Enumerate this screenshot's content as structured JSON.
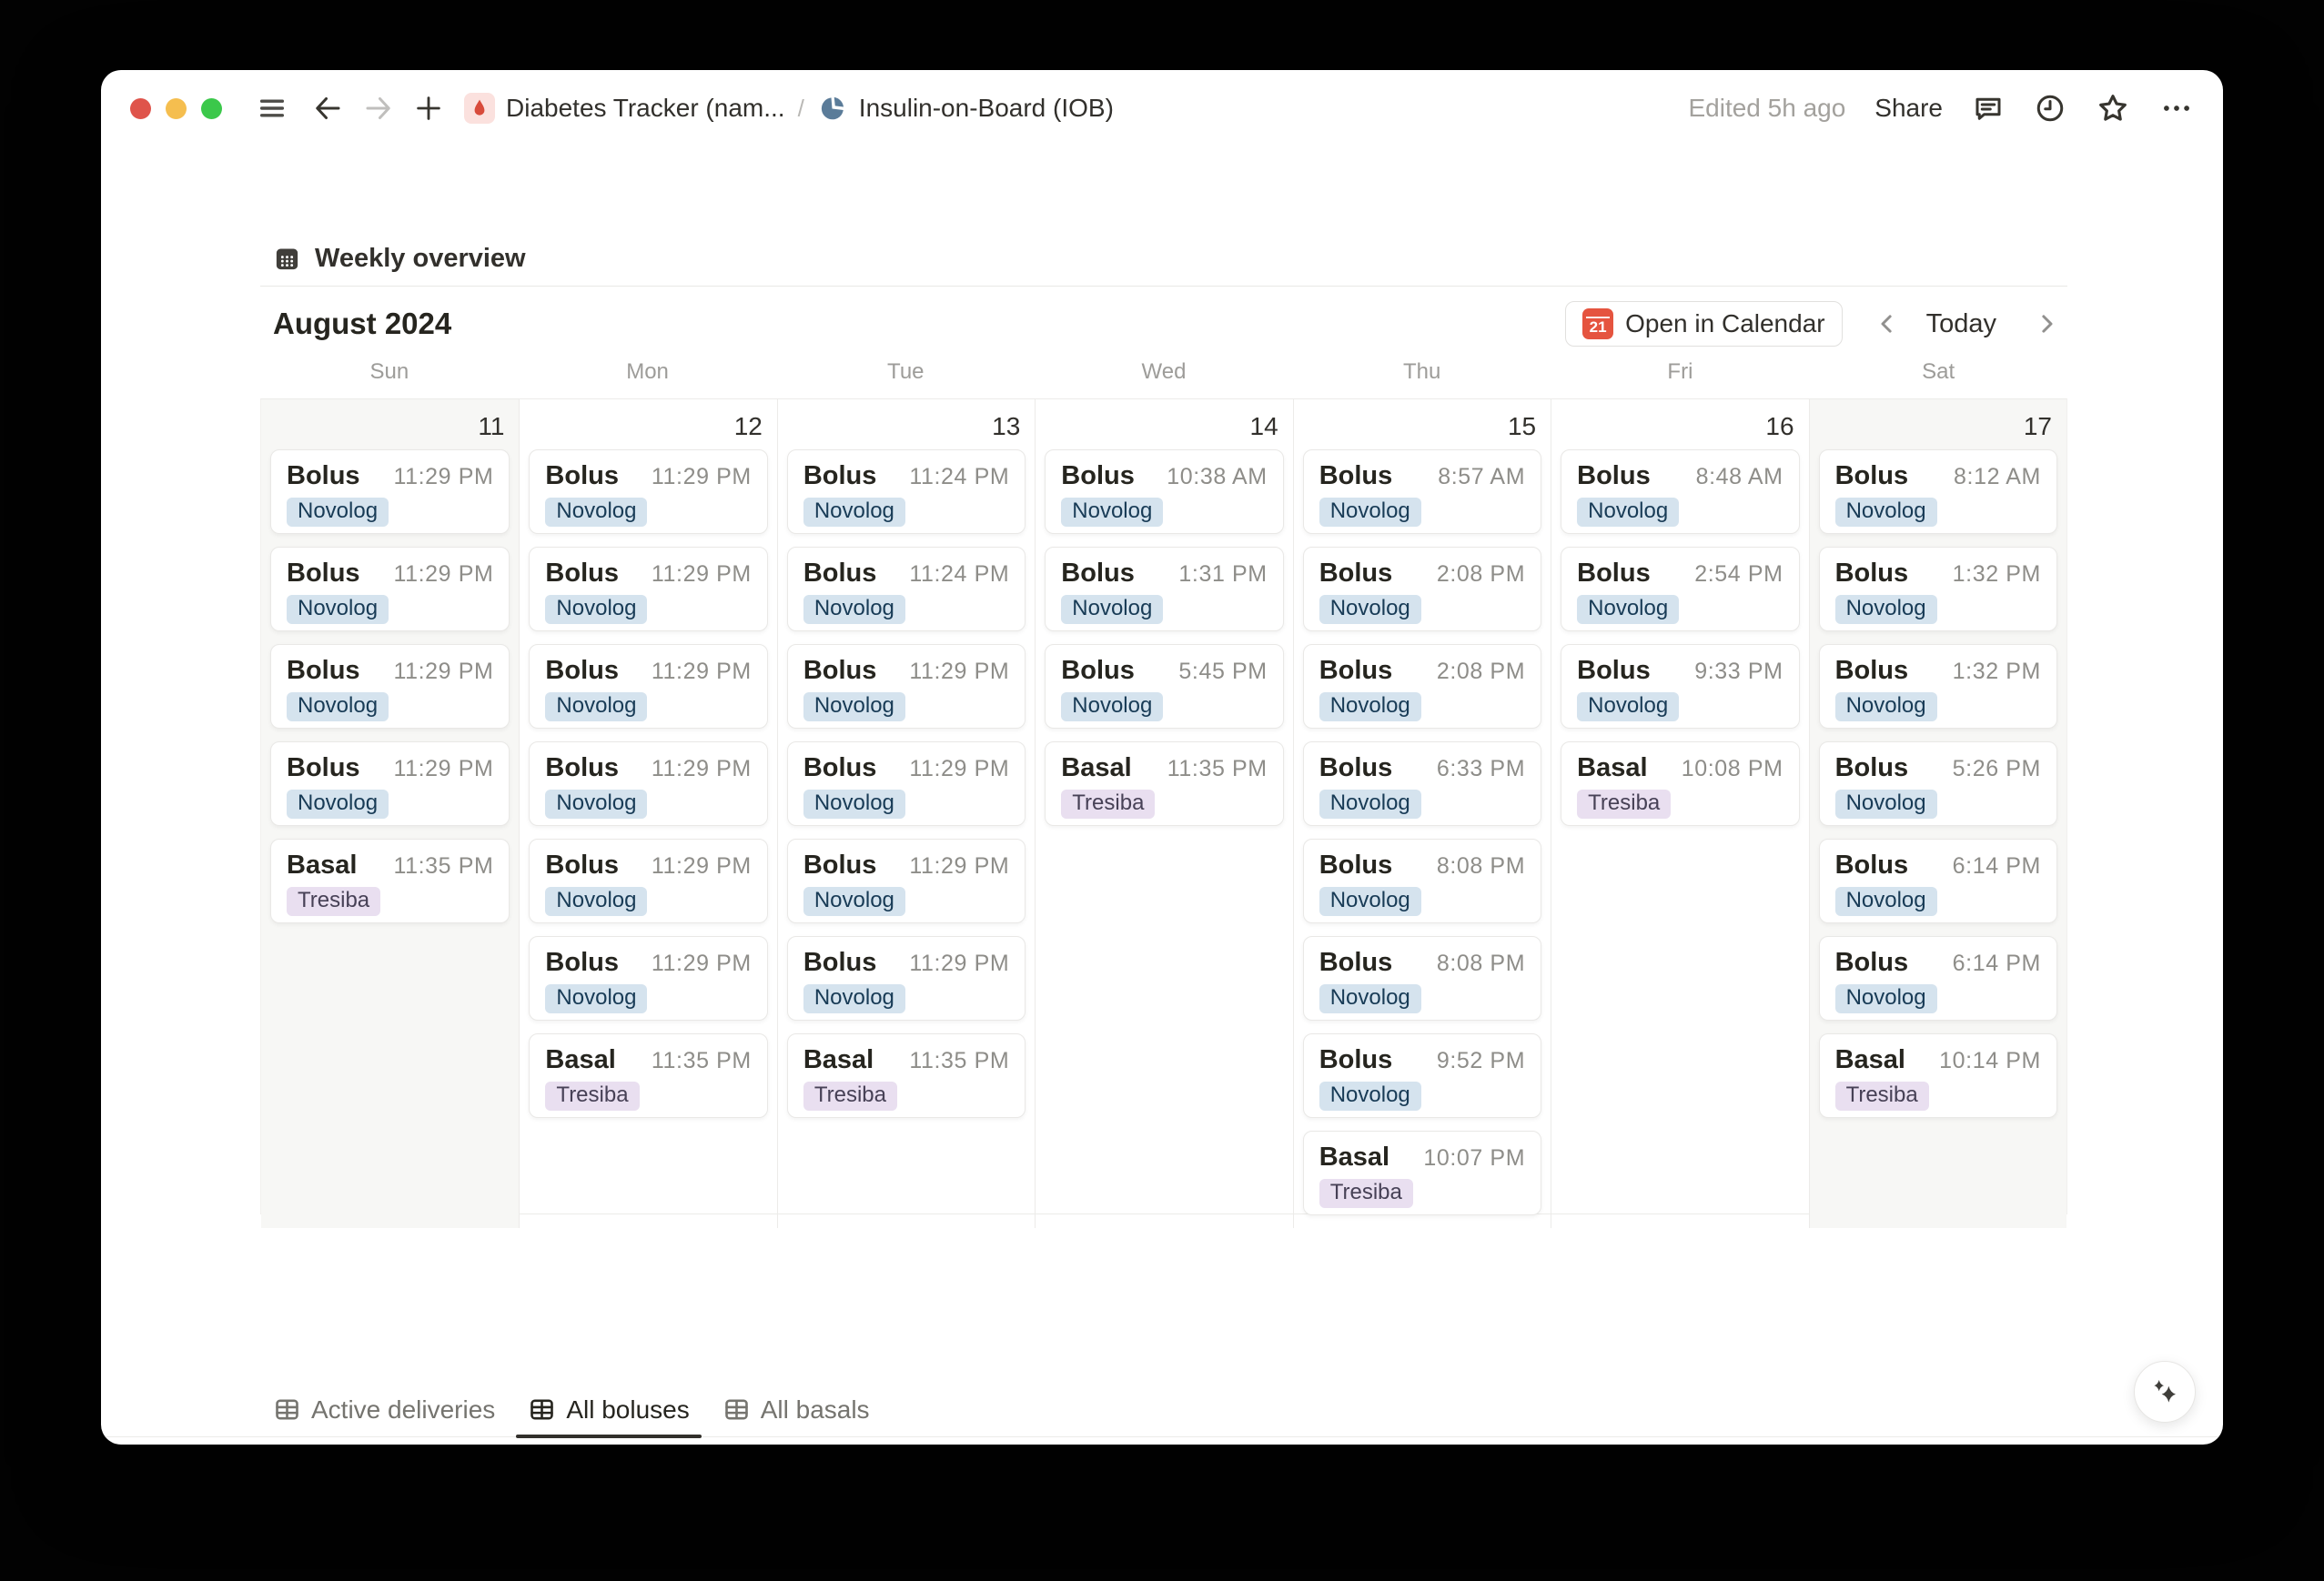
{
  "window": {
    "topbar": {
      "breadcrumb_root": "Diabetes Tracker (nam...",
      "breadcrumb_separator": "/",
      "breadcrumb_page": "Insulin-on-Board (IOB)",
      "edited_label": "Edited 5h ago",
      "share_label": "Share"
    },
    "view_header": {
      "title": "Weekly overview",
      "month_label": "August 2024",
      "open_in_calendar_label": "Open in Calendar",
      "calendar_badge_day": "21",
      "today_label": "Today"
    },
    "calendar": {
      "weekday_headers": [
        "Sun",
        "Mon",
        "Tue",
        "Wed",
        "Thu",
        "Fri",
        "Sat"
      ],
      "days": [
        {
          "date": "11",
          "weekend": true,
          "events": [
            {
              "title": "Bolus",
              "time": "11:29 PM",
              "tag": "Novolog",
              "tag_color": "blue"
            },
            {
              "title": "Bolus",
              "time": "11:29 PM",
              "tag": "Novolog",
              "tag_color": "blue"
            },
            {
              "title": "Bolus",
              "time": "11:29 PM",
              "tag": "Novolog",
              "tag_color": "blue"
            },
            {
              "title": "Bolus",
              "time": "11:29 PM",
              "tag": "Novolog",
              "tag_color": "blue"
            },
            {
              "title": "Basal",
              "time": "11:35 PM",
              "tag": "Tresiba",
              "tag_color": "purple"
            }
          ]
        },
        {
          "date": "12",
          "weekend": false,
          "events": [
            {
              "title": "Bolus",
              "time": "11:29 PM",
              "tag": "Novolog",
              "tag_color": "blue"
            },
            {
              "title": "Bolus",
              "time": "11:29 PM",
              "tag": "Novolog",
              "tag_color": "blue"
            },
            {
              "title": "Bolus",
              "time": "11:29 PM",
              "tag": "Novolog",
              "tag_color": "blue"
            },
            {
              "title": "Bolus",
              "time": "11:29 PM",
              "tag": "Novolog",
              "tag_color": "blue"
            },
            {
              "title": "Bolus",
              "time": "11:29 PM",
              "tag": "Novolog",
              "tag_color": "blue"
            },
            {
              "title": "Bolus",
              "time": "11:29 PM",
              "tag": "Novolog",
              "tag_color": "blue"
            },
            {
              "title": "Basal",
              "time": "11:35 PM",
              "tag": "Tresiba",
              "tag_color": "purple"
            }
          ]
        },
        {
          "date": "13",
          "weekend": false,
          "events": [
            {
              "title": "Bolus",
              "time": "11:24 PM",
              "tag": "Novolog",
              "tag_color": "blue"
            },
            {
              "title": "Bolus",
              "time": "11:24 PM",
              "tag": "Novolog",
              "tag_color": "blue"
            },
            {
              "title": "Bolus",
              "time": "11:29 PM",
              "tag": "Novolog",
              "tag_color": "blue"
            },
            {
              "title": "Bolus",
              "time": "11:29 PM",
              "tag": "Novolog",
              "tag_color": "blue"
            },
            {
              "title": "Bolus",
              "time": "11:29 PM",
              "tag": "Novolog",
              "tag_color": "blue"
            },
            {
              "title": "Bolus",
              "time": "11:29 PM",
              "tag": "Novolog",
              "tag_color": "blue"
            },
            {
              "title": "Basal",
              "time": "11:35 PM",
              "tag": "Tresiba",
              "tag_color": "purple"
            }
          ]
        },
        {
          "date": "14",
          "weekend": false,
          "events": [
            {
              "title": "Bolus",
              "time": "10:38 AM",
              "tag": "Novolog",
              "tag_color": "blue"
            },
            {
              "title": "Bolus",
              "time": "1:31 PM",
              "tag": "Novolog",
              "tag_color": "blue"
            },
            {
              "title": "Bolus",
              "time": "5:45 PM",
              "tag": "Novolog",
              "tag_color": "blue"
            },
            {
              "title": "Basal",
              "time": "11:35 PM",
              "tag": "Tresiba",
              "tag_color": "purple"
            }
          ]
        },
        {
          "date": "15",
          "weekend": false,
          "events": [
            {
              "title": "Bolus",
              "time": "8:57 AM",
              "tag": "Novolog",
              "tag_color": "blue"
            },
            {
              "title": "Bolus",
              "time": "2:08 PM",
              "tag": "Novolog",
              "tag_color": "blue"
            },
            {
              "title": "Bolus",
              "time": "2:08 PM",
              "tag": "Novolog",
              "tag_color": "blue"
            },
            {
              "title": "Bolus",
              "time": "6:33 PM",
              "tag": "Novolog",
              "tag_color": "blue"
            },
            {
              "title": "Bolus",
              "time": "8:08 PM",
              "tag": "Novolog",
              "tag_color": "blue"
            },
            {
              "title": "Bolus",
              "time": "8:08 PM",
              "tag": "Novolog",
              "tag_color": "blue"
            },
            {
              "title": "Bolus",
              "time": "9:52 PM",
              "tag": "Novolog",
              "tag_color": "blue"
            },
            {
              "title": "Basal",
              "time": "10:07 PM",
              "tag": "Tresiba",
              "tag_color": "purple"
            }
          ]
        },
        {
          "date": "16",
          "weekend": false,
          "events": [
            {
              "title": "Bolus",
              "time": "8:48 AM",
              "tag": "Novolog",
              "tag_color": "blue"
            },
            {
              "title": "Bolus",
              "time": "2:54 PM",
              "tag": "Novolog",
              "tag_color": "blue"
            },
            {
              "title": "Bolus",
              "time": "9:33 PM",
              "tag": "Novolog",
              "tag_color": "blue"
            },
            {
              "title": "Basal",
              "time": "10:08 PM",
              "tag": "Tresiba",
              "tag_color": "purple"
            }
          ]
        },
        {
          "date": "17",
          "weekend": true,
          "events": [
            {
              "title": "Bolus",
              "time": "8:12 AM",
              "tag": "Novolog",
              "tag_color": "blue"
            },
            {
              "title": "Bolus",
              "time": "1:32 PM",
              "tag": "Novolog",
              "tag_color": "blue"
            },
            {
              "title": "Bolus",
              "time": "1:32 PM",
              "tag": "Novolog",
              "tag_color": "blue"
            },
            {
              "title": "Bolus",
              "time": "5:26 PM",
              "tag": "Novolog",
              "tag_color": "blue"
            },
            {
              "title": "Bolus",
              "time": "6:14 PM",
              "tag": "Novolog",
              "tag_color": "blue"
            },
            {
              "title": "Bolus",
              "time": "6:14 PM",
              "tag": "Novolog",
              "tag_color": "blue"
            },
            {
              "title": "Basal",
              "time": "10:14 PM",
              "tag": "Tresiba",
              "tag_color": "purple"
            }
          ]
        }
      ]
    },
    "footer_tabs": [
      {
        "label": "Active deliveries",
        "active": false
      },
      {
        "label": "All boluses",
        "active": true
      },
      {
        "label": "All basals",
        "active": false
      }
    ]
  },
  "colors": {
    "novolog_bg": "#D5E3EE",
    "novolog_text": "#183B56",
    "tresiba_bg": "#E9DFF0",
    "tresiba_text": "#474156",
    "calendar_badge": "#E5543F",
    "droplet": "#D84B3B",
    "droplet_bg": "#FBE1DE",
    "pie_icon": "#5B7C99"
  }
}
